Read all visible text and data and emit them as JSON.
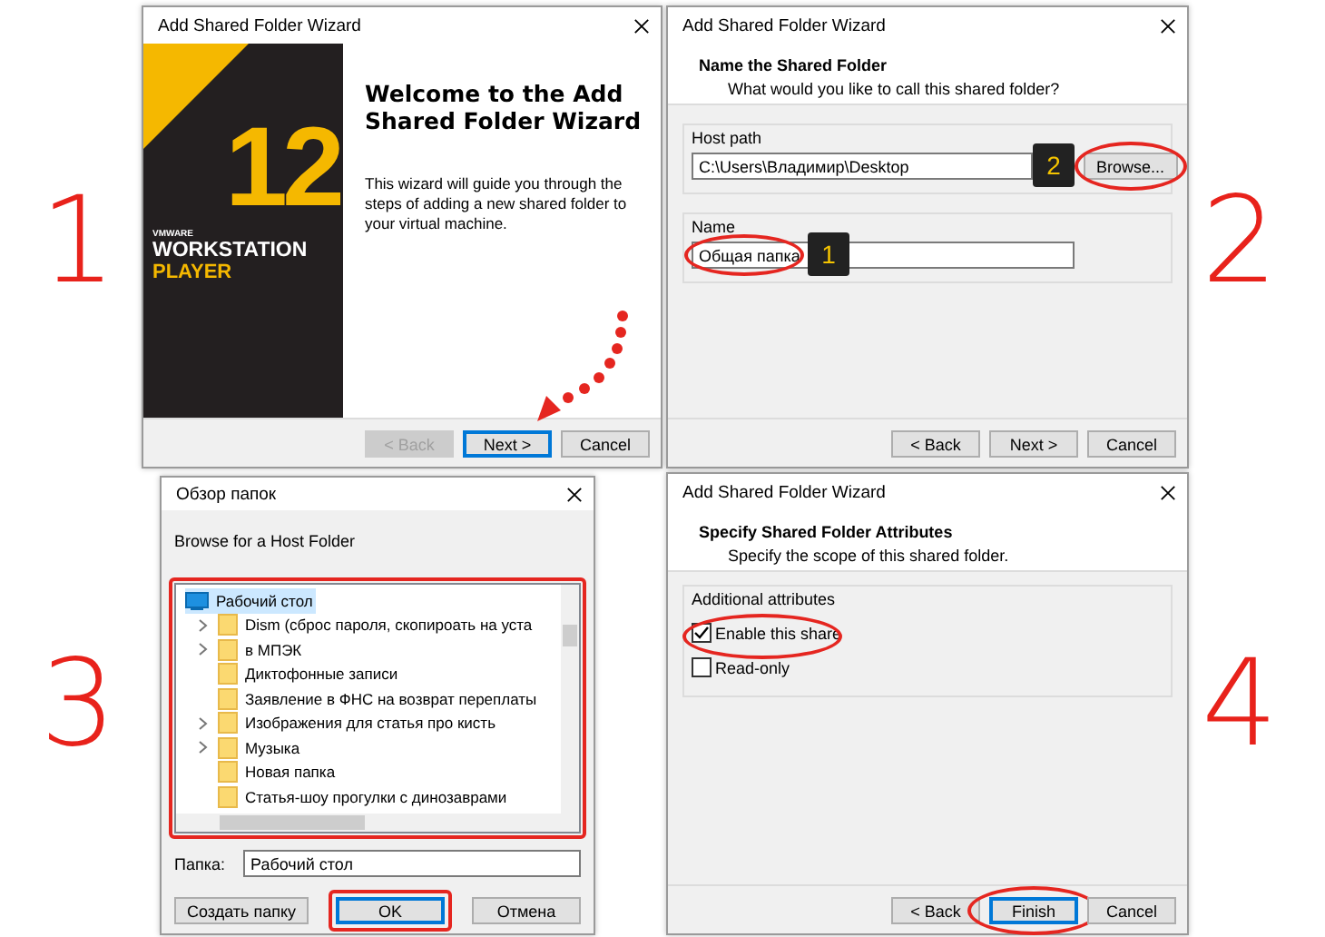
{
  "step_numbers": [
    {
      "number": "1"
    },
    {
      "number": "2"
    },
    {
      "number": "3"
    },
    {
      "number": "4"
    }
  ],
  "welcome_wizard": {
    "title": "Add Shared Folder Wizard",
    "logo": {
      "brand": "VMWARE",
      "product": "WORKSTATION",
      "edition": "PLAYER",
      "version": "12"
    },
    "heading": "Welcome to the Add Shared Folder Wizard",
    "text": "This wizard will guide you through the steps of adding a new shared folder to your virtual machine.",
    "buttons": [
      {
        "label": "< Back",
        "disabled": true,
        "focused": false
      },
      {
        "label": "Next >",
        "disabled": false,
        "focused": true
      },
      {
        "label": "Cancel",
        "disabled": false,
        "focused": false
      }
    ]
  },
  "name_wizard": {
    "title": "Add Shared Folder Wizard",
    "heading": "Name the Shared Folder",
    "subheading": "What would you like to call this shared folder?",
    "host_path": {
      "label": "Host path",
      "value": "C:\\Users\\Владимир\\Desktop",
      "callout": "2",
      "browse_button": {
        "label": "Browse...",
        "circled": true
      }
    },
    "name": {
      "label": "Name",
      "value": "Общая папка",
      "circled": true,
      "callout": "1"
    },
    "buttons": [
      {
        "label": "< Back",
        "disabled": false,
        "focused": false
      },
      {
        "label": "Next >",
        "disabled": false,
        "focused": false
      },
      {
        "label": "Cancel",
        "disabled": false,
        "focused": false
      }
    ]
  },
  "browse_dialog": {
    "title": "Обзор папок",
    "prompt": "Browse for a Host Folder",
    "tree": {
      "boxed": true,
      "items": [
        {
          "label": "Рабочий стол",
          "kind": "desktop",
          "selected": true,
          "children": [
            {
              "label": "Dism (сброс пароля, скопироать на уста",
              "kind": "folder",
              "expandable": true,
              "selected": false
            },
            {
              "label": "в МПЭК",
              "kind": "folder",
              "expandable": true,
              "selected": false
            },
            {
              "label": "Диктофонные записи",
              "kind": "folder",
              "expandable": false,
              "selected": false
            },
            {
              "label": "Заявление в ФНС на возврат переплаты",
              "kind": "folder",
              "expandable": false,
              "selected": false
            },
            {
              "label": "Изображения для статья про кисть",
              "kind": "folder",
              "expandable": true,
              "selected": false
            },
            {
              "label": "Музыка",
              "kind": "folder",
              "expandable": true,
              "selected": false
            },
            {
              "label": "Новая папка",
              "kind": "folder",
              "expandable": false,
              "selected": false
            },
            {
              "label": "Статья-шоу прогулки с динозаврами",
              "kind": "folder",
              "expandable": false,
              "selected": false
            }
          ]
        }
      ]
    },
    "folder": {
      "label": "Папка:",
      "value": "Рабочий стол"
    },
    "buttons": [
      {
        "label": "Создать папку",
        "focused": false,
        "boxed": false
      },
      {
        "label": "OK",
        "focused": true,
        "boxed": true
      },
      {
        "label": "Отмена",
        "focused": false,
        "boxed": false
      }
    ]
  },
  "attributes_wizard": {
    "title": "Add Shared Folder Wizard",
    "heading": "Specify Shared Folder Attributes",
    "subheading": "Specify the scope of this shared folder.",
    "group_label": "Additional attributes",
    "options": [
      {
        "label": "Enable this share",
        "checked": true,
        "circled": true
      },
      {
        "label": "Read-only",
        "checked": false,
        "circled": false
      }
    ],
    "buttons": [
      {
        "label": "< Back",
        "disabled": false,
        "focused": false,
        "circled": false
      },
      {
        "label": "Finish",
        "disabled": false,
        "focused": true,
        "circled": true
      },
      {
        "label": "Cancel",
        "disabled": false,
        "focused": false,
        "circled": false
      }
    ]
  }
}
